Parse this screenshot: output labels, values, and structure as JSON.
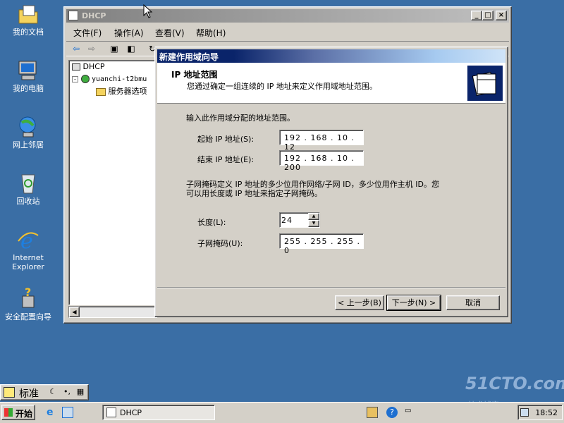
{
  "desktop": {
    "icons": [
      {
        "label": "我的文档",
        "icon": "my-documents-icon"
      },
      {
        "label": "我的电脑",
        "icon": "my-computer-icon"
      },
      {
        "label": "网上邻居",
        "icon": "network-places-icon"
      },
      {
        "label": "回收站",
        "icon": "recycle-bin-icon"
      },
      {
        "label1": "Internet",
        "label2": "Explorer",
        "icon": "ie-icon"
      },
      {
        "label": "安全配置向导",
        "icon": "security-wizard-icon"
      }
    ],
    "watermark": "51CTO.com",
    "watermark_sub": "技术博客—Blog"
  },
  "dhcp_window": {
    "title": "DHCP",
    "menu": [
      "文件(F)",
      "操作(A)",
      "查看(V)",
      "帮助(H)"
    ],
    "tree": [
      "DHCP",
      "yuanchi-t2bmu",
      "服务器选项"
    ]
  },
  "wizard": {
    "title": "新建作用域向导",
    "header_title": "IP 地址范围",
    "header_desc": "您通过确定一组连续的 IP 地址来定义作用域地址范围。",
    "prompt": "输入此作用域分配的地址范围。",
    "start_ip_label": "起始 IP 地址(S):",
    "start_ip": "192 . 168 . 10 . 12",
    "end_ip_label": "结束 IP 地址(E):",
    "end_ip": "192 . 168 . 10 . 200",
    "subnet_desc_1": "子网掩码定义 IP 地址的多少位用作网络/子网 ID，多少位用作主机 ID。您",
    "subnet_desc_2": "可以用长度或 IP 地址来指定子网掩码。",
    "length_label": "长度(L):",
    "length": "24",
    "mask_label": "子网掩码(U):",
    "mask": "255 . 255 . 255 . 0",
    "back": "< 上一步(B)",
    "next": "下一步(N) >",
    "cancel": "取消"
  },
  "ime": {
    "label": "标准"
  },
  "taskbar": {
    "start": "开始",
    "task": "DHCP",
    "clock": "18:52"
  }
}
